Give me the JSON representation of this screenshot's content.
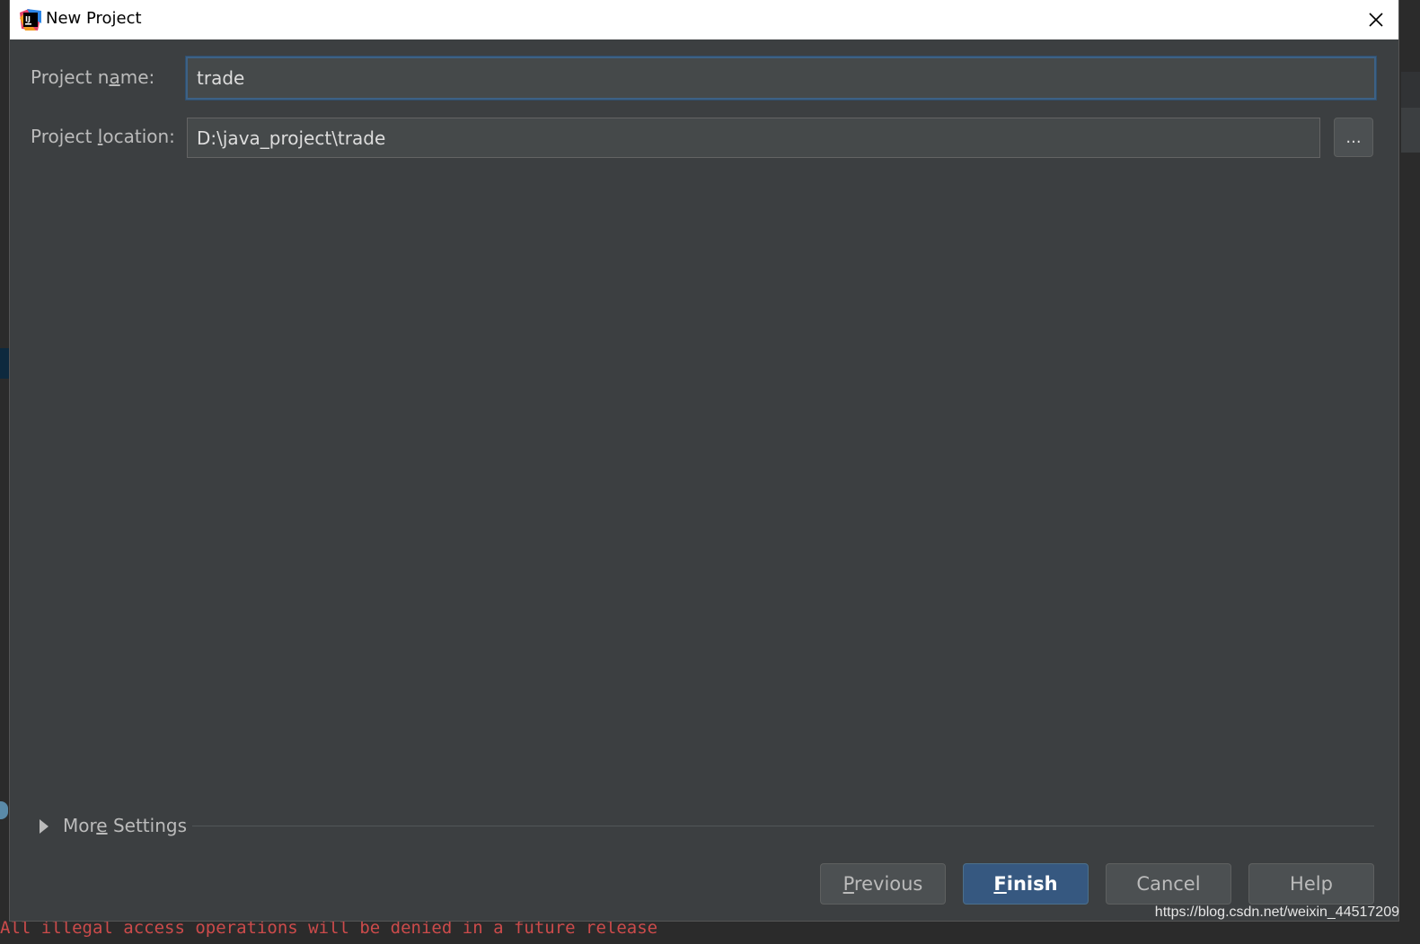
{
  "dialog": {
    "title": "New Project",
    "project_name_label_pre": "Project n",
    "project_name_label_u": "a",
    "project_name_label_post": "me:",
    "project_name_value": "trade",
    "project_location_label_pre": "Project ",
    "project_location_label_u": "l",
    "project_location_label_post": "ocation:",
    "project_location_value": "D:\\java_project\\trade",
    "browse_label": "...",
    "more_settings_pre": "Mor",
    "more_settings_u": "e",
    "more_settings_post": " Settings",
    "buttons": {
      "previous_u": "P",
      "previous_rest": "revious",
      "finish_u": "F",
      "finish_rest": "inish",
      "cancel": "Cancel",
      "help": "Help"
    }
  },
  "background": {
    "console_text": "All illegal access operations will be denied in a future release",
    "watermark": "https://blog.csdn.net/weixin_44517209"
  },
  "colors": {
    "dialog_bg": "#3c3f41",
    "field_bg": "#45494a",
    "focus_border": "#3d6185",
    "primary_button": "#365880",
    "console_error": "#cc4b4b"
  }
}
